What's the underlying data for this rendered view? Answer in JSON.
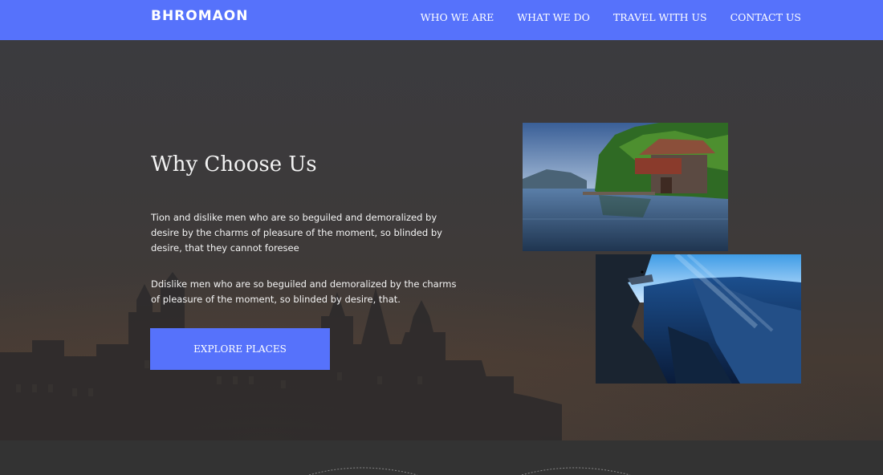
{
  "brand": {
    "name": "BHROMAON"
  },
  "nav": {
    "items": [
      {
        "label": "WHO WE ARE"
      },
      {
        "label": "WHAT WE DO"
      },
      {
        "label": "TRAVEL WITH US"
      },
      {
        "label": "CONTACT US"
      }
    ]
  },
  "hero": {
    "title": "Why Choose Us",
    "paragraph_1": "Tion and dislike men who are so beguiled and demoralized by desire by the charms of pleasure of the moment, so blinded by desire, that they cannot foresee",
    "paragraph_2": "Ddislike men who are so beguiled and demoralized by the charms of pleasure of the moment, so blinded by desire, that.",
    "cta_label": "EXPLORE PLACES"
  },
  "photos": [
    {
      "icon": "lake-boathouse-photo"
    },
    {
      "icon": "mountain-canyon-photo"
    }
  ],
  "colors": {
    "accent": "#5672fb",
    "hero_overlay": "#3c3a3b",
    "footer": "#333333"
  }
}
